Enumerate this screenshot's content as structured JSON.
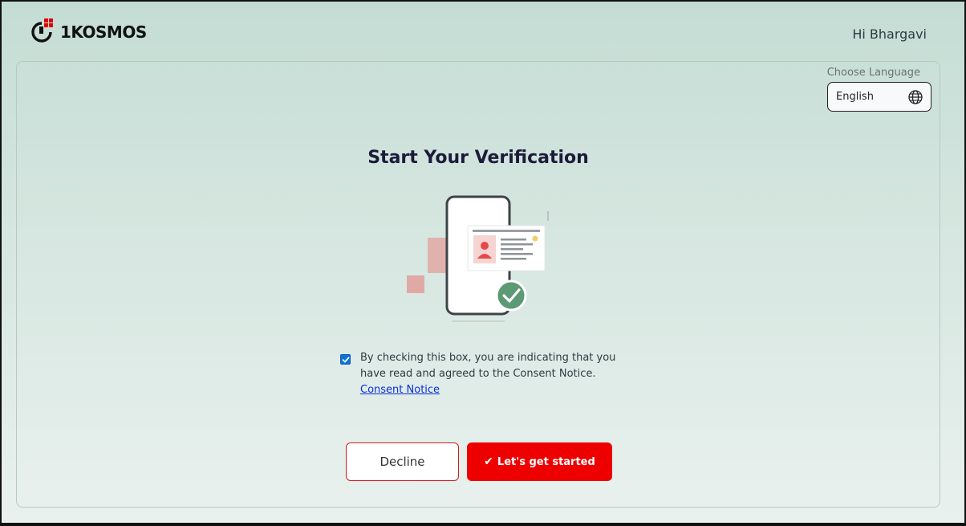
{
  "brand": {
    "name": "1KOSMOS"
  },
  "header": {
    "greeting": "Hi Bhargavi"
  },
  "language": {
    "label": "Choose Language",
    "selected": "English"
  },
  "main": {
    "title": "Start Your Verification",
    "consent_text": "By checking this box, you are indicating that you have read and agreed to the Consent Notice.",
    "consent_link": "Consent Notice",
    "consent_checked": true
  },
  "actions": {
    "decline_label": "Decline",
    "start_label": "Let's get started"
  },
  "colors": {
    "accent_red": "#ee0000",
    "title": "#1c1b3a",
    "checkbox": "#0b72d8",
    "success_green": "#5b9a74"
  },
  "icons": [
    "1kosmos-logo-icon",
    "globe-icon",
    "phone-id-illustration",
    "check-icon"
  ]
}
